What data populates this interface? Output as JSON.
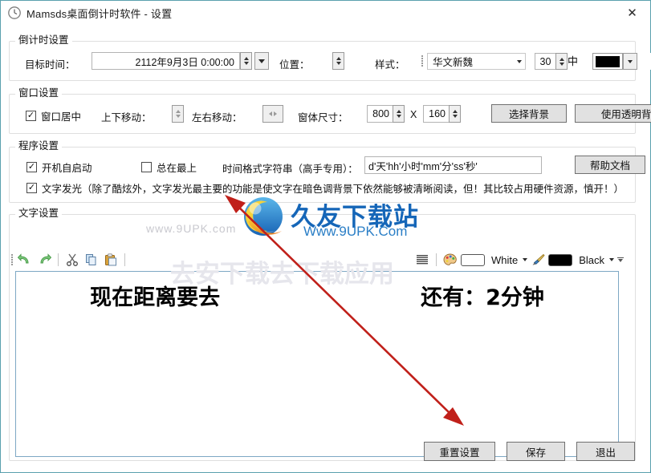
{
  "window": {
    "title": "Mamsds桌面倒计时软件 - 设置",
    "icon": "clock-icon",
    "close_label": "✕",
    "border_color": "#5aa0ae"
  },
  "countdown_group": {
    "title": "倒计时设置",
    "target_time_label": "目标时间：",
    "target_time_value": "2112年9月3日 0:00:00",
    "position_label": "位置：",
    "style_label": "样式：",
    "font_value": "华文新魏",
    "font_size_value": "30",
    "color_value": "#000000",
    "align_value": "居中"
  },
  "window_group": {
    "title": "窗口设置",
    "center_checkbox_label": "窗口居中",
    "center_checked": true,
    "vertical_move_label": "上下移动：",
    "horizontal_move_label": "左右移动：",
    "size_label": "窗体尺寸：",
    "width_value": "800",
    "size_separator": "X",
    "height_value": "160",
    "choose_bg_label": "选择背景",
    "transparent_bg_label": "使用透明背景(荐!)"
  },
  "program_group": {
    "title": "程序设置",
    "autostart_label": "开机自启动",
    "autostart_checked": true,
    "always_on_top_label": "总在最上",
    "always_on_top_checked": false,
    "time_format_label": "时间格式字符串（高手专用）：",
    "time_format_value": "d'天'hh'小时'mm'分'ss'秒'",
    "help_doc_label": "帮助文档",
    "glow_label": "文字发光（除了酷炫外，文字发光最主要的功能是使文字在暗色调背景下依然能够被清晰阅读，但！其比较占用硬件资源，慎开！）",
    "glow_checked": true
  },
  "text_group": {
    "title": "文字设置",
    "toolbar": {
      "undo": "undo-icon",
      "redo": "redo-icon",
      "cut": "cut-icon",
      "copy": "copy-icon",
      "paste": "paste-icon",
      "align": "align-justify-icon",
      "palette": "palette-icon",
      "fore_color_name": "White",
      "fore_color_value": "#ffffff",
      "brush": "brush-icon",
      "back_color_name": "Black",
      "back_color_value": "#000000",
      "overflow": "overflow-chevron-icon"
    },
    "editor_text_left": "现在距离要去",
    "editor_text_right": "还有：2分钟"
  },
  "footer": {
    "reset_label": "重置设置",
    "save_label": "保存",
    "exit_label": "退出"
  },
  "watermark": {
    "site_name": "久友下载站",
    "site_url": "Www.9UPK.Com",
    "url_faint": "www.9UPK.com",
    "bg_text": "去安下载去下载应用"
  }
}
